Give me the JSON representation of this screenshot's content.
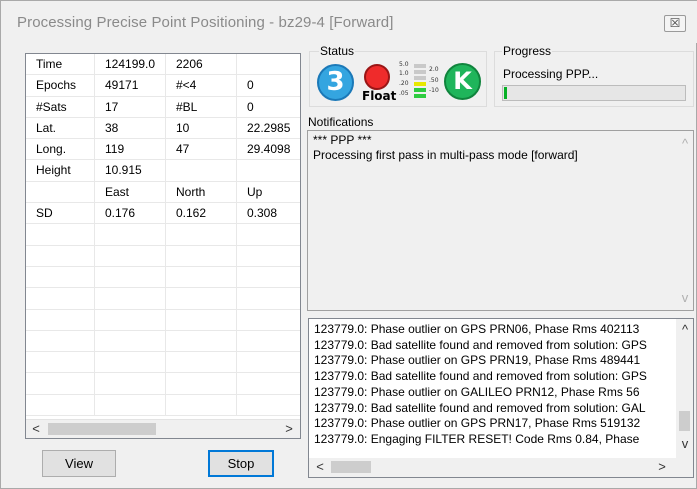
{
  "window": {
    "title": "Processing Precise Point Positioning - bz29-4 [Forward]",
    "close_glyph": "☒"
  },
  "table": {
    "rows": [
      [
        "Time",
        "124199.0",
        "2206",
        ""
      ],
      [
        "Epochs",
        "49171",
        "#<4",
        "0"
      ],
      [
        "#Sats",
        "17",
        "#BL",
        "0"
      ],
      [
        "Lat.",
        "38",
        "10",
        "22.2985"
      ],
      [
        "Long.",
        "119",
        "47",
        "29.4098"
      ],
      [
        "Height",
        "10.915",
        "",
        ""
      ],
      [
        "",
        "East",
        "North",
        "Up"
      ],
      [
        "SD",
        "0.176",
        "0.162",
        "0.308"
      ],
      [
        "",
        "",
        "",
        ""
      ],
      [
        "",
        "",
        "",
        ""
      ],
      [
        "",
        "",
        "",
        ""
      ],
      [
        "",
        "",
        "",
        ""
      ],
      [
        "",
        "",
        "",
        ""
      ],
      [
        "",
        "",
        "",
        ""
      ],
      [
        "",
        "",
        "",
        ""
      ],
      [
        "",
        "",
        "",
        ""
      ],
      [
        "",
        "",
        "",
        ""
      ]
    ],
    "scroll_left": "<",
    "scroll_right": ">"
  },
  "buttons": {
    "view": "View",
    "stop": "Stop"
  },
  "status": {
    "label": "Status",
    "sats_badge": "3",
    "solution_label": "Float",
    "k_badge": "K",
    "meter_left": [
      "5.0",
      "1.0",
      ".20",
      ".05"
    ],
    "meter_right": [
      "2.0",
      ".50",
      "-10"
    ]
  },
  "progress": {
    "label": "Progress",
    "text": "Processing PPP...",
    "fraction": 0.015
  },
  "notifications": {
    "label": "Notifications",
    "lines": [
      "*** PPP ***",
      "Processing first pass in multi-pass mode [forward]"
    ],
    "scroll_up": "^",
    "scroll_down": "v"
  },
  "log": {
    "lines": [
      "123779.0: Phase outlier on GPS PRN06, Phase Rms 402113",
      "123779.0: Bad satellite found and removed from solution: GPS",
      "123779.0: Phase outlier on GPS PRN19, Phase Rms 489441",
      "123779.0: Bad satellite found and removed from solution: GPS",
      "123779.0: Phase outlier on GALILEO PRN12, Phase Rms 56",
      "123779.0: Bad satellite found and removed from solution: GAL",
      "123779.0: Phase outlier on GPS PRN17, Phase Rms 519132",
      "123779.0: Engaging FILTER RESET! Code Rms 0.84, Phase"
    ],
    "scroll_up": "^",
    "scroll_down": "v",
    "scroll_left": "<",
    "scroll_right": ">"
  },
  "colors": {
    "progress_fill": "#06b025",
    "badge_blue": "#34a5e0",
    "float_red": "#ef2b2b",
    "k_green": "#1fb55b"
  }
}
